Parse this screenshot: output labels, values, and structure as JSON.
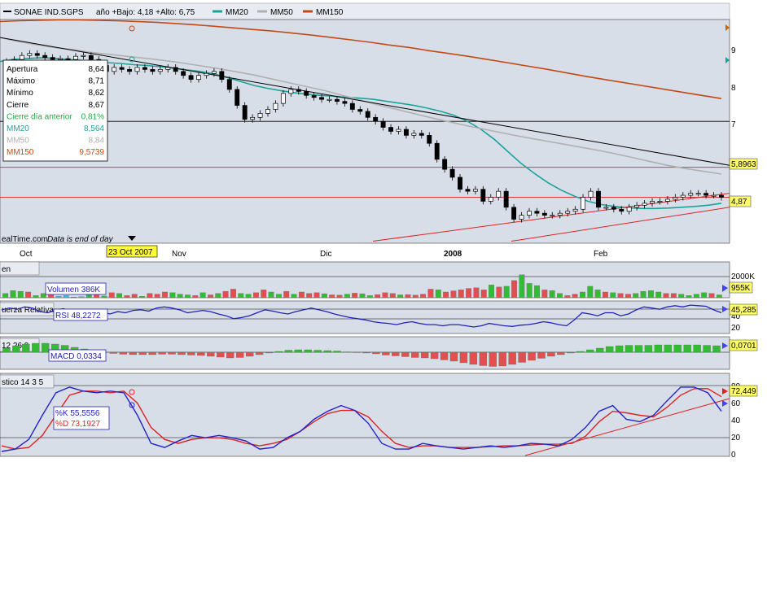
{
  "header": {
    "symbol": "SONAE IND.SGPS",
    "range_text": "año +Bajo: 4,18 +Alto: 6,75",
    "legend": [
      {
        "label": "MM20",
        "color": "#1aa39a"
      },
      {
        "label": "MM50",
        "color": "#b0b0b0"
      },
      {
        "label": "MM150",
        "color": "#c24a16"
      }
    ]
  },
  "colors": {
    "panel_bg": "#d8dee8",
    "up": "#ffffff",
    "down": "#000000",
    "vol_green": "#33bb33",
    "vol_red": "#e05050",
    "vol_cyan": "#33bbdd",
    "rsi": "#2222bb",
    "stoch_k": "#2222cc",
    "stoch_d": "#dd2222",
    "trend_red": "#dd2222",
    "trend_black": "#000000"
  },
  "info_box": {
    "rows": [
      {
        "label": "Apertura",
        "value": "8,64",
        "color": "#000000"
      },
      {
        "label": "Máximo",
        "value": "8,71",
        "color": "#000000"
      },
      {
        "label": "Mínimo",
        "value": "8,62",
        "color": "#000000"
      },
      {
        "label": "Cierre",
        "value": "8,67",
        "color": "#000000"
      },
      {
        "label": "Cierre día anterior",
        "value": "0,81%",
        "color": "#22aa44"
      },
      {
        "label": "MM20",
        "value": "8,564",
        "color": "#1aa39a"
      },
      {
        "label": "MM50",
        "value": "8,84",
        "color": "#b0b0b0"
      },
      {
        "label": "MM150",
        "value": "9,5739",
        "color": "#c24a16"
      }
    ]
  },
  "footer": {
    "source": "ealTime.com",
    "note": "Data is end of day",
    "cursor_date": "23 Oct 2007"
  },
  "x_labels": [
    "Oct",
    "Nov",
    "Dic",
    "2008",
    "Feb"
  ],
  "price_axis": {
    "ticks": [
      "9",
      "8",
      "7"
    ],
    "tag_top": "5,8963",
    "tag_bottom": "4,87"
  },
  "volume": {
    "title": "en",
    "label": "Volumen 386K",
    "axis_tick": "2000K",
    "tag": "955K"
  },
  "rsi": {
    "title": "uerza Relativa",
    "label": "RSI 48,2272",
    "tick_a": "40",
    "tick_b": "20",
    "tag": "45,285"
  },
  "macd": {
    "title": "12 26 9",
    "label": "MACD 0,0334",
    "tag": "0,0701"
  },
  "stoch": {
    "title": "stico 14 3 5",
    "label_k": "%K 55,5556",
    "label_d": "%D 73,1927",
    "tag": "72,449",
    "ticks": [
      "80",
      "60",
      "40",
      "20",
      "0"
    ]
  },
  "chart_data": [
    {
      "type": "candlestick",
      "title": "SONAE IND.SGPS",
      "x_ticks": [
        "Oct",
        "Nov",
        "Dic",
        "2008",
        "Feb"
      ],
      "y_ticks": [
        9,
        8,
        7
      ],
      "ylim": [
        4.0,
        9.6
      ],
      "close": [
        8.5,
        8.6,
        8.7,
        8.75,
        8.7,
        8.65,
        8.6,
        8.62,
        8.6,
        8.68,
        8.7,
        8.6,
        8.45,
        8.3,
        8.4,
        8.35,
        8.3,
        8.4,
        8.35,
        8.3,
        8.35,
        8.4,
        8.3,
        8.2,
        8.1,
        8.2,
        8.25,
        8.3,
        8.1,
        7.85,
        7.45,
        7.1,
        7.15,
        7.25,
        7.35,
        7.5,
        7.75,
        7.85,
        7.8,
        7.7,
        7.65,
        7.6,
        7.6,
        7.55,
        7.5,
        7.35,
        7.3,
        7.15,
        7.05,
        6.9,
        6.8,
        6.85,
        6.7,
        6.75,
        6.7,
        6.5,
        6.1,
        5.85,
        5.65,
        5.35,
        5.3,
        5.35,
        5.05,
        5.15,
        5.3,
        4.9,
        4.6,
        4.7,
        4.8,
        4.75,
        4.7,
        4.7,
        4.75,
        4.8,
        4.85,
        5.15,
        5.3,
        4.9,
        4.9,
        4.85,
        4.8,
        4.9,
        4.95,
        5.0,
        5.05,
        5.05,
        5.1,
        5.15,
        5.2,
        5.25,
        5.25,
        5.2,
        5.2,
        5.15
      ],
      "series": [
        {
          "name": "MM20",
          "values": [
            8.55,
            8.6,
            8.62,
            8.64,
            8.63,
            8.6,
            8.58,
            8.55,
            8.52,
            8.5,
            8.47,
            8.45,
            8.42,
            8.38,
            8.34,
            8.3,
            8.24,
            8.15,
            8.05,
            7.95,
            7.88,
            7.82,
            7.77,
            7.73,
            7.7,
            7.68,
            7.65,
            7.63,
            7.6,
            7.55,
            7.5,
            7.45,
            7.38,
            7.3,
            7.2,
            7.05,
            6.85,
            6.6,
            6.3,
            6.0,
            5.75,
            5.52,
            5.33,
            5.18,
            5.05,
            4.97,
            4.92,
            4.89,
            4.87,
            4.87,
            4.88,
            4.9,
            4.92,
            4.95,
            5.0
          ]
        },
        {
          "name": "MM50",
          "values": [
            9.15,
            9.05,
            8.97,
            8.9,
            8.85,
            8.78,
            8.73,
            8.68,
            8.63,
            8.58,
            8.52,
            8.45,
            8.38,
            8.3,
            8.22,
            8.12,
            8.02,
            7.92,
            7.82,
            7.7,
            7.58,
            7.46,
            7.35,
            7.24,
            7.13,
            7.03,
            6.93,
            6.84,
            6.75,
            6.66,
            6.58,
            6.5,
            6.42,
            6.34,
            6.25,
            6.15,
            6.05,
            5.95,
            5.87,
            5.8,
            5.73
          ]
        },
        {
          "name": "MM150",
          "values": [
            9.55,
            9.57,
            9.58,
            9.59,
            9.59,
            9.58,
            9.57,
            9.55,
            9.53,
            9.5,
            9.47,
            9.43,
            9.39,
            9.35,
            9.31,
            9.26,
            9.21,
            9.15,
            9.09,
            9.03,
            8.96,
            8.9,
            8.82,
            8.75,
            8.68,
            8.6,
            8.52,
            8.44,
            8.36,
            8.27,
            8.18,
            8.1,
            8.02,
            7.94,
            7.86,
            7.78,
            7.7,
            7.62
          ]
        }
      ],
      "price_levels": [
        7.05,
        5.9,
        5.15
      ]
    },
    {
      "type": "bar",
      "title": "Volumen",
      "ylim": [
        0,
        2500
      ],
      "values": [
        300,
        500,
        450,
        400,
        150,
        300,
        350,
        100,
        150,
        50,
        80,
        200,
        250,
        120,
        350,
        300,
        150,
        250,
        100,
        300,
        250,
        400,
        350,
        250,
        200,
        150,
        350,
        200,
        300,
        450,
        600,
        300,
        250,
        350,
        550,
        400,
        250,
        450,
        250,
        400,
        300,
        350,
        280,
        200,
        180,
        250,
        320,
        280,
        150,
        220,
        350,
        300,
        200,
        220,
        180,
        250,
        600,
        550,
        400,
        480,
        550,
        650,
        700,
        550,
        900,
        750,
        800,
        1200,
        1600,
        1000,
        850,
        550,
        500,
        300,
        150,
        250,
        400,
        800,
        550,
        400,
        350,
        300,
        250,
        300,
        450,
        500,
        400,
        300,
        300,
        250,
        150,
        250,
        350,
        300,
        200
      ],
      "colors": [
        "g",
        "g",
        "g",
        "r",
        "g",
        "g",
        "r",
        "c",
        "c",
        "g",
        "c",
        "g",
        "r",
        "g",
        "r",
        "g",
        "r",
        "r",
        "g",
        "r",
        "r",
        "r",
        "g",
        "g",
        "g",
        "r",
        "g",
        "r",
        "g",
        "r",
        "r",
        "g",
        "g",
        "r",
        "r",
        "g",
        "g",
        "r",
        "g",
        "r",
        "r",
        "r",
        "g",
        "r",
        "r",
        "g",
        "r",
        "g",
        "g",
        "r",
        "r",
        "r",
        "g",
        "r",
        "r",
        "r",
        "r",
        "g",
        "r",
        "r",
        "r",
        "r",
        "r",
        "r",
        "g",
        "r",
        "g",
        "r",
        "g",
        "g",
        "g",
        "r",
        "g",
        "g",
        "r",
        "r",
        "g",
        "g",
        "g",
        "r",
        "g",
        "r",
        "r",
        "g",
        "g",
        "g",
        "g",
        "r",
        "r",
        "g",
        "g",
        "g",
        "g",
        "r",
        "g"
      ]
    },
    {
      "type": "line",
      "title": "Fuerza Relativa (RSI)",
      "ylim": [
        0,
        100
      ],
      "y_ticks": [
        40,
        20
      ],
      "series": [
        {
          "name": "RSI",
          "values": [
            55,
            58,
            56,
            60,
            58,
            52,
            50,
            55,
            57,
            52,
            53,
            50,
            49,
            51,
            48,
            52,
            50,
            54,
            55,
            53,
            58,
            60,
            58,
            55,
            50,
            52,
            54,
            52,
            48,
            45,
            40,
            42,
            45,
            50,
            55,
            53,
            50,
            48,
            52,
            55,
            58,
            55,
            52,
            48,
            45,
            42,
            40,
            38,
            35,
            33,
            32,
            30,
            33,
            35,
            32,
            30,
            30,
            28,
            30,
            30,
            28,
            26,
            28,
            32,
            30,
            28,
            27,
            29,
            30,
            32,
            35,
            33,
            30,
            28,
            38,
            50,
            48,
            45,
            50,
            50,
            45,
            48,
            55,
            60,
            58,
            56,
            60,
            62,
            60,
            63,
            62,
            61,
            55,
            50
          ]
        }
      ]
    },
    {
      "type": "bar",
      "title": "MACD 12 26 9",
      "values": [
        0.1,
        0.16,
        0.2,
        0.22,
        0.22,
        0.2,
        0.17,
        0.12,
        0.08,
        0.04,
        0.0,
        -0.03,
        -0.05,
        -0.06,
        -0.06,
        -0.06,
        -0.05,
        -0.05,
        -0.06,
        -0.07,
        -0.08,
        -0.1,
        -0.12,
        -0.14,
        -0.13,
        -0.1,
        -0.06,
        -0.02,
        0.02,
        0.05,
        0.06,
        0.06,
        0.05,
        0.04,
        0.03,
        0.01,
        -0.01,
        -0.02,
        -0.04,
        -0.07,
        -0.09,
        -0.11,
        -0.13,
        -0.14,
        -0.16,
        -0.19,
        -0.22,
        -0.26,
        -0.3,
        -0.33,
        -0.35,
        -0.34,
        -0.3,
        -0.25,
        -0.2,
        -0.15,
        -0.1,
        -0.06,
        -0.02,
        0.02,
        0.06,
        0.1,
        0.14,
        0.16,
        0.17,
        0.17,
        0.17,
        0.18,
        0.18,
        0.18,
        0.18,
        0.18,
        0.17,
        0.16
      ]
    },
    {
      "type": "line",
      "title": "Estocástico 14 3 5",
      "ylim": [
        0,
        100
      ],
      "y_ticks": [
        80,
        60,
        40,
        20,
        0
      ],
      "series": [
        {
          "name": "%K",
          "values": [
            5,
            8,
            20,
            50,
            78,
            85,
            80,
            78,
            80,
            78,
            50,
            15,
            10,
            18,
            25,
            22,
            25,
            22,
            18,
            8,
            10,
            22,
            30,
            45,
            55,
            62,
            56,
            40,
            15,
            8,
            8,
            15,
            12,
            10,
            8,
            10,
            12,
            10,
            12,
            15,
            14,
            12,
            20,
            35,
            55,
            62,
            45,
            42,
            50,
            68,
            85,
            85,
            78,
            55
          ]
        },
        {
          "name": "%D",
          "values": [
            12,
            8,
            10,
            25,
            50,
            75,
            80,
            80,
            78,
            80,
            65,
            35,
            20,
            15,
            20,
            22,
            22,
            20,
            15,
            12,
            15,
            20,
            30,
            42,
            52,
            56,
            56,
            48,
            30,
            15,
            10,
            12,
            12,
            10,
            10,
            10,
            11,
            12,
            12,
            13,
            14,
            14,
            15,
            24,
            42,
            55,
            53,
            50,
            48,
            60,
            75,
            83,
            83,
            73
          ]
        }
      ]
    }
  ]
}
